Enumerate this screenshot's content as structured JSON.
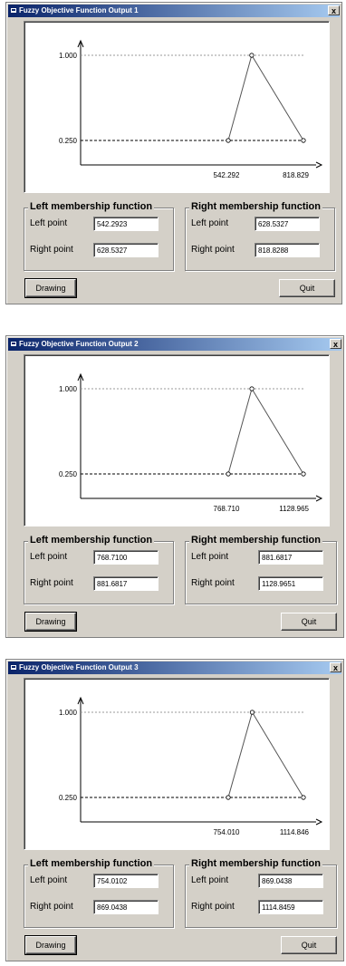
{
  "windows": [
    {
      "title": "Fuzzy Objective Function Output 1",
      "close_glyph": "x",
      "chart_data": {
        "type": "line",
        "title": "",
        "xlabel": "",
        "ylabel": "",
        "x_ticks": [
          "542.292",
          "818.829"
        ],
        "y_ticks": [
          "1.000",
          "0.250"
        ],
        "series": [
          {
            "values": [
              [
                542.292,
                0.25
              ],
              [
                628.5327,
                1.0
              ],
              [
                818.829,
                0.25
              ]
            ]
          }
        ],
        "reference_lines": [
          1.0,
          0.25
        ]
      },
      "left_group": {
        "legend": "Left membership function",
        "left_label": "Left point",
        "left_value": "542.2923",
        "right_label": "Right point",
        "right_value": "628.5327"
      },
      "right_group": {
        "legend": "Right membership function",
        "left_label": "Left point",
        "left_value": "628.5327",
        "right_label": "Right point",
        "right_value": "818.8288"
      },
      "drawing_label": "Drawing",
      "quit_label": "Quit"
    },
    {
      "title": "Fuzzy Objective Function Output 2",
      "close_glyph": "x",
      "chart_data": {
        "type": "line",
        "title": "",
        "xlabel": "",
        "ylabel": "",
        "x_ticks": [
          "768.710",
          "1128.965"
        ],
        "y_ticks": [
          "1.000",
          "0.250"
        ],
        "series": [
          {
            "values": [
              [
                768.71,
                0.25
              ],
              [
                881.6817,
                1.0
              ],
              [
                1128.965,
                0.25
              ]
            ]
          }
        ],
        "reference_lines": [
          1.0,
          0.25
        ]
      },
      "left_group": {
        "legend": "Left membership function",
        "left_label": "Left point",
        "left_value": "768.7100",
        "right_label": "Right point",
        "right_value": "881.6817"
      },
      "right_group": {
        "legend": "Right membership function",
        "left_label": "Left point",
        "left_value": "881.6817",
        "right_label": "Right point",
        "right_value": "1128.9651"
      },
      "drawing_label": "Drawing",
      "quit_label": "Quit"
    },
    {
      "title": "Fuzzy Objective Function Output 3",
      "close_glyph": "x",
      "chart_data": {
        "type": "line",
        "title": "",
        "xlabel": "",
        "ylabel": "",
        "x_ticks": [
          "754.010",
          "1114.846"
        ],
        "y_ticks": [
          "1.000",
          "0.250"
        ],
        "series": [
          {
            "values": [
              [
                754.01,
                0.25
              ],
              [
                869.0438,
                1.0
              ],
              [
                1114.846,
                0.25
              ]
            ]
          }
        ],
        "reference_lines": [
          1.0,
          0.25
        ]
      },
      "left_group": {
        "legend": "Left membership function",
        "left_label": "Left point",
        "left_value": "754.0102",
        "right_label": "Right point",
        "right_value": "869.0438"
      },
      "right_group": {
        "legend": "Right membership function",
        "left_label": "Left point",
        "left_value": "869.0438",
        "right_label": "Right point",
        "right_value": "1114.8459"
      },
      "drawing_label": "Drawing",
      "quit_label": "Quit"
    }
  ]
}
